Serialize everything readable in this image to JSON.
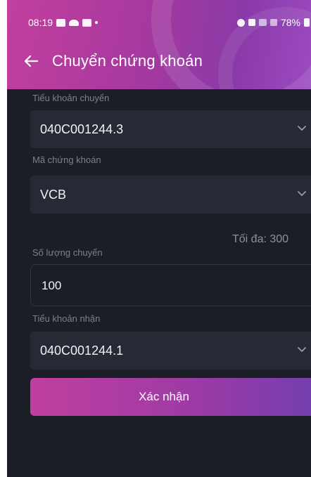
{
  "status_bar": {
    "time": "08:19",
    "battery": "78%"
  },
  "header": {
    "title": "Chuyển chứng khoán"
  },
  "form": {
    "source_account": {
      "label": "Tiểu khoản chuyển",
      "value": "040C001244.3"
    },
    "stock_code": {
      "label": "Mã chứng khoán",
      "value": "VCB"
    },
    "max_text": "Tối đa: 300",
    "quantity": {
      "label": "Số lượng chuyển",
      "value": "100"
    },
    "target_account": {
      "label": "Tiểu khoản nhận",
      "value": "040C001244.1"
    },
    "confirm_label": "Xác nhận"
  },
  "colors": {
    "background": "#1b1e27",
    "field": "#262a35",
    "accent_start": "#c03f9f",
    "accent_end": "#6f3fb0"
  }
}
